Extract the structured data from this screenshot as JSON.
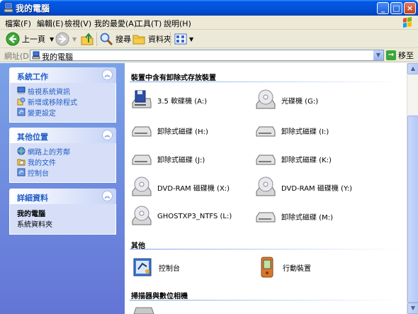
{
  "window": {
    "title": "我的電腦"
  },
  "menu": [
    {
      "label": "檔案(F)"
    },
    {
      "label": "編輯(E)"
    },
    {
      "label": "檢視(V)"
    },
    {
      "label": "我的最愛(A)"
    },
    {
      "label": "工具(T)"
    },
    {
      "label": "說明(H)"
    }
  ],
  "toolbar": {
    "back_label": "上一頁",
    "search_label": "搜尋",
    "folders_label": "資料夾"
  },
  "address": {
    "label": "網址(D)",
    "value": "我的電腦",
    "go_label": "移至"
  },
  "tasks": {
    "system": {
      "title": "系統工作",
      "items": [
        {
          "label": "檢視系統資訊",
          "icon": "system-info-icon"
        },
        {
          "label": "新增或移除程式",
          "icon": "add-remove-programs-icon"
        },
        {
          "label": "變更設定",
          "icon": "control-panel-icon"
        }
      ]
    },
    "other": {
      "title": "其他位置",
      "items": [
        {
          "label": "網路上的芳鄰",
          "icon": "network-places-icon"
        },
        {
          "label": "我的文件",
          "icon": "my-documents-icon"
        },
        {
          "label": "控制台",
          "icon": "control-panel-icon"
        }
      ]
    },
    "details": {
      "title": "詳細資料",
      "name": "我的電腦",
      "type": "系統資料夾"
    }
  },
  "groups": {
    "removable": {
      "title": "裝置中含有卸除式存放裝置",
      "items": [
        {
          "label": "3.5 軟碟機 (A:)",
          "icon": "floppy-drive-icon"
        },
        {
          "label": "光碟機 (G:)",
          "icon": "cd-drive-icon"
        },
        {
          "label": "卸除式磁碟 (H:)",
          "icon": "removable-disk-icon"
        },
        {
          "label": "卸除式磁碟 (I:)",
          "icon": "removable-disk-icon"
        },
        {
          "label": "卸除式磁碟 (J:)",
          "icon": "removable-disk-icon"
        },
        {
          "label": "卸除式磁碟 (K:)",
          "icon": "removable-disk-icon"
        },
        {
          "label": "DVD-RAM 磁碟機 (X:)",
          "icon": "dvd-drive-icon"
        },
        {
          "label": "DVD-RAM 磁碟機 (Y:)",
          "icon": "dvd-drive-icon"
        },
        {
          "label": "GHOSTXP3_NTFS (L:)",
          "icon": "cd-drive-icon"
        },
        {
          "label": "卸除式磁碟 (M:)",
          "icon": "removable-disk-icon"
        }
      ]
    },
    "other": {
      "title": "其他",
      "items": [
        {
          "label": "控制台",
          "icon": "control-panel-icon"
        },
        {
          "label": "行動裝置",
          "icon": "mobile-device-icon"
        }
      ]
    },
    "scanners": {
      "title": "掃描器與數位相機"
    }
  },
  "colors": {
    "title_bar": "#0453d9",
    "task_pane": "#6f8fe0",
    "link": "#215dc6"
  }
}
